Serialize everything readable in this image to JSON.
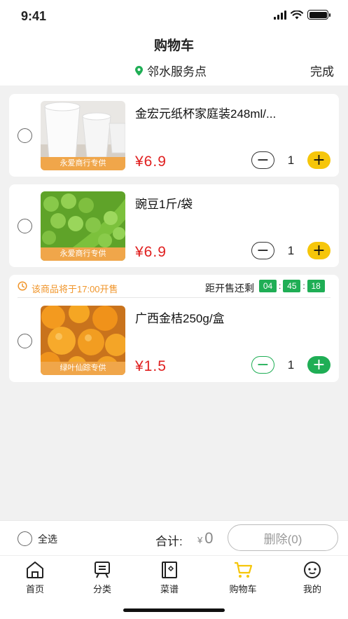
{
  "status_bar": {
    "time": "9:41"
  },
  "header": {
    "title": "购物车",
    "location": "邻水服务点",
    "done_label": "完成"
  },
  "colors": {
    "accent_yellow": "#f6c60a",
    "accent_green": "#1fae55",
    "price_red": "#e02020",
    "tag_orange": "#f0a64a",
    "notice_orange": "#f0952a"
  },
  "cart": {
    "items": [
      {
        "title": "金宏元纸杯家庭装248ml/...",
        "price": "¥6.9",
        "quantity": "1",
        "tag": "永爱商行专供"
      },
      {
        "title": "豌豆1斤/袋",
        "price": "¥6.9",
        "quantity": "1",
        "tag": "永爱商行专供"
      }
    ],
    "presale": {
      "notice": "该商品将于17:00开售",
      "countdown_label": "距开售还剩",
      "countdown": {
        "h": "04",
        "m": "45",
        "s": "18"
      },
      "item": {
        "title": "广西金桔250g/盒",
        "price": "¥1.5",
        "quantity": "1",
        "tag": "绿叶仙踪专供"
      }
    }
  },
  "footer": {
    "select_all": "全选",
    "total_label": "合计:",
    "currency": "¥",
    "total": "0",
    "delete_label": "删除(0)"
  },
  "tabs": [
    {
      "label": "首页",
      "icon": "home-icon"
    },
    {
      "label": "分类",
      "icon": "category-icon"
    },
    {
      "label": "菜谱",
      "icon": "recipe-icon"
    },
    {
      "label": "购物车",
      "icon": "cart-icon",
      "active": true
    },
    {
      "label": "我的",
      "icon": "profile-icon"
    }
  ]
}
